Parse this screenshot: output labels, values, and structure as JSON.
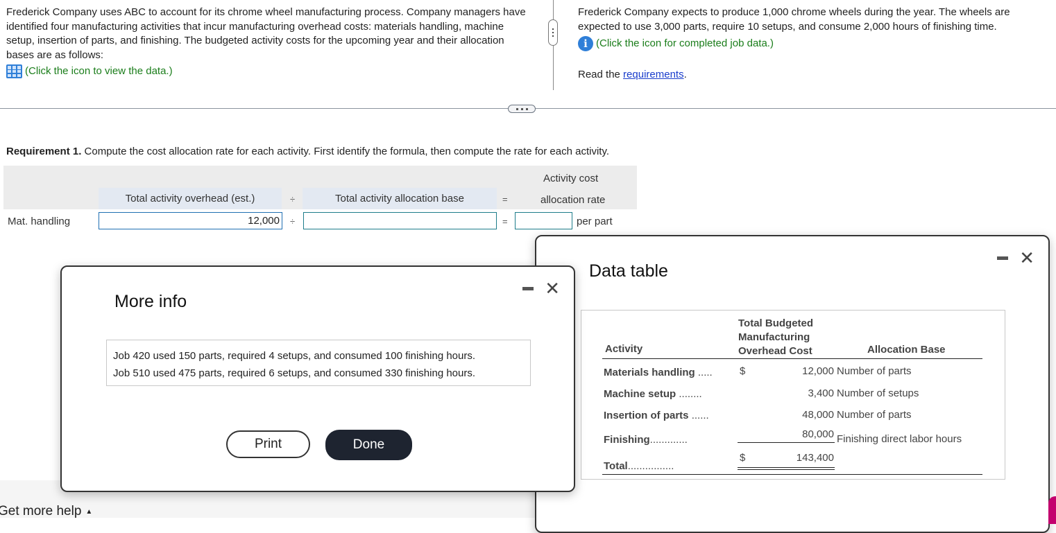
{
  "intro_left": {
    "text": "Frederick Company uses ABC to account for its chrome wheel manufacturing process. Company managers have identified four manufacturing activities that incur manufacturing overhead costs: materials handling, machine setup, insertion of parts, and finishing. The budgeted activity costs for the upcoming year and their allocation bases are as follows:",
    "link_icon": "grid-table-icon",
    "link_text": "(Click the icon to view the data.)"
  },
  "intro_right": {
    "text": "Frederick Company expects to produce 1,000 chrome wheels during the year. The wheels are expected to use 3,000 parts, require 10 setups, and consume 2,000 hours of finishing time.",
    "link_icon": "info-icon",
    "link_text": "(Click the icon for completed job data.)",
    "read_prefix": "Read the ",
    "read_link": "requirements",
    "read_suffix": "."
  },
  "requirement": {
    "label": "Requirement 1.",
    "text": " Compute the cost allocation rate for each activity. First identify the formula, then compute the rate for each activity."
  },
  "formula": {
    "col1_header": "Total activity overhead (est.)",
    "divide_op": "÷",
    "col2_header": "Total activity allocation base",
    "equals_op": "=",
    "col3_header_line1": "Activity cost",
    "col3_header_line2": "allocation rate",
    "rows": [
      {
        "label": "Mat. handling",
        "overhead_value": "12,000",
        "base_value": "",
        "rate_value": "",
        "unit": "per part"
      }
    ]
  },
  "more_info_modal": {
    "title": "More info",
    "lines": [
      "Job 420 used 150 parts, required 4 setups, and consumed 100 finishing hours.",
      "Job 510 used 475 parts, required 6 setups, and consumed 330 finishing hours."
    ],
    "print_label": "Print",
    "done_label": "Done"
  },
  "data_table_modal": {
    "title": "Data table",
    "headers": {
      "activity": "Activity",
      "cost_line1": "Total Budgeted",
      "cost_line2": "Manufacturing",
      "cost_line3": "Overhead Cost",
      "base": "Allocation Base"
    },
    "rows": [
      {
        "activity": "Materials handling",
        "dots": ".....",
        "currency": "$",
        "cost": "12,000",
        "base": "Number of parts"
      },
      {
        "activity": "Machine setup",
        "dots": "........",
        "currency": "",
        "cost": "3,400",
        "base": "Number of setups"
      },
      {
        "activity": "Insertion of parts",
        "dots": "......",
        "currency": "",
        "cost": "48,000",
        "base": "Number of parts"
      },
      {
        "activity": "Finishing",
        "dots": ".............",
        "currency": "",
        "cost": "80,000",
        "base": "Finishing direct labor hours"
      }
    ],
    "total": {
      "activity": "Total",
      "dots": "................",
      "currency": "$",
      "cost": "143,400"
    }
  },
  "footer": {
    "help_label": "Get more help",
    "help_icon": "caret-up-icon"
  }
}
